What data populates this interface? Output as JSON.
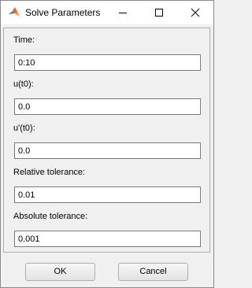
{
  "window": {
    "title": "Solve Parameters",
    "icon": "matlab-logo-icon",
    "controls": {
      "minimize": "minimize-icon",
      "maximize": "maximize-icon",
      "close": "close-icon"
    }
  },
  "fields": [
    {
      "label": "Time:",
      "value": "0:10"
    },
    {
      "label": "u(t0):",
      "value": "0.0"
    },
    {
      "label": "u'(t0):",
      "value": "0.0"
    },
    {
      "label": "Relative tolerance:",
      "value": "0.01"
    },
    {
      "label": "Absolute tolerance:",
      "value": "0.001"
    }
  ],
  "buttons": {
    "ok_label": "OK",
    "cancel_label": "Cancel"
  },
  "colors": {
    "titlebar": "#ffffff",
    "dialog_background": "#f0f0f0",
    "input_border": "#7a7a7a"
  }
}
